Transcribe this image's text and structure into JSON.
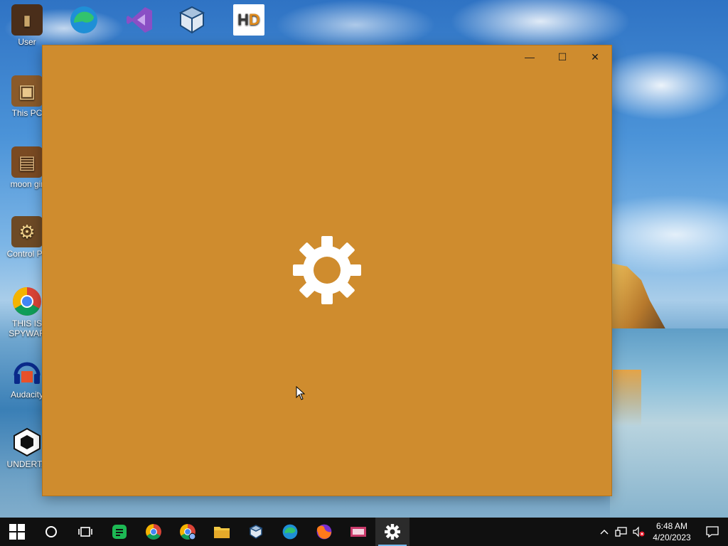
{
  "desktop": {
    "icons": [
      {
        "label": "User",
        "icon": "user-folder-icon"
      },
      {
        "label": "This PC",
        "icon": "this-pc-icon"
      },
      {
        "label": "moon gir",
        "icon": "file-icon"
      },
      {
        "label": "Control Pa",
        "icon": "control-panel-icon"
      },
      {
        "label": "THIS IS SPYWAR",
        "icon": "chrome-icon"
      },
      {
        "label": "Audacity",
        "icon": "audacity-icon"
      },
      {
        "label": "UNDERTA",
        "icon": "unity-icon"
      }
    ],
    "top_icons": [
      {
        "label": "",
        "icon": "edge-icon"
      },
      {
        "label": "",
        "icon": "visual-studio-icon"
      },
      {
        "label": "",
        "icon": "virtualbox-icon"
      },
      {
        "label": "",
        "icon": "hxd-icon"
      }
    ]
  },
  "window": {
    "background": "#cf8c2e",
    "minimize": "—",
    "maximize": "☐",
    "close": "✕",
    "splash_icon": "gear-icon"
  },
  "taskbar": {
    "apps": [
      "start-icon",
      "search-circle-icon",
      "task-view-icon",
      "spotify-like-icon",
      "chrome-icon",
      "chrome-alt-icon",
      "file-explorer-icon",
      "virtualbox-icon",
      "edge-icon",
      "firefox-icon",
      "app-icon",
      "settings-gear-icon"
    ],
    "time": "6:48 AM",
    "date": "4/20/2023"
  }
}
